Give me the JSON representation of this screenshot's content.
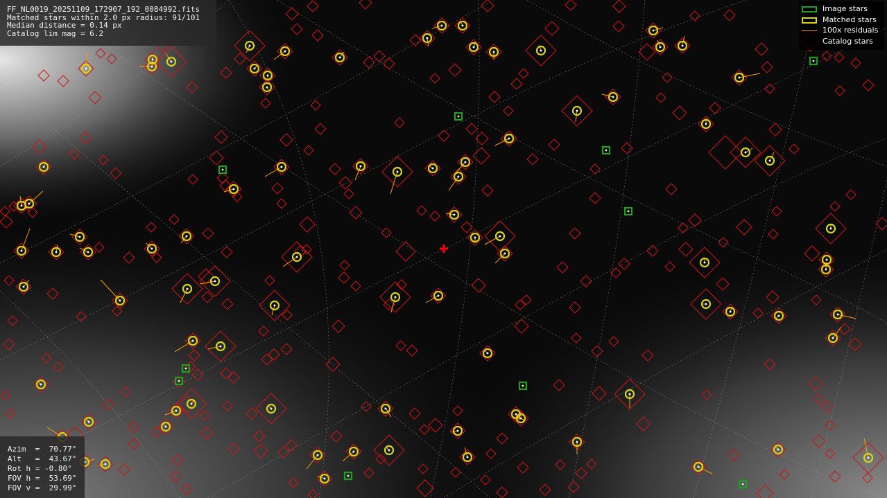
{
  "info": {
    "filename": "FF_NL0019_20251109_172907_192_0084992.fits",
    "matched": "Matched stars within 2.0 px radius: 91/101",
    "median": "Median distance = 0.14 px",
    "limmag": "Catalog lim mag = 6.2"
  },
  "pointing": {
    "azim": "Azim  =  70.77°",
    "alt": "Alt   =  43.67°",
    "roth": "Rot h = -0.80°",
    "fovh": "FOV h =  53.69°",
    "fovv": "FOV v =  29.99°"
  },
  "legend": {
    "image_stars": "Image stars",
    "matched_stars": "Matched stars",
    "residuals": "100x residuals",
    "catalog_stars": "Catalog stars"
  },
  "colors": {
    "image_star": "#1fa01f",
    "matched_star": "#d6d61a",
    "residual": "#ff9d00",
    "catalog_star": "#d01515",
    "center_marker": "#ff0000",
    "grid": "#9a9a9a"
  },
  "icons": {
    "image_star": "green-square-icon",
    "matched_star": "yellow-circle-icon",
    "residual": "orange-line-icon",
    "catalog_star": "red-diamond-icon",
    "center": "red-cross-icon"
  }
}
